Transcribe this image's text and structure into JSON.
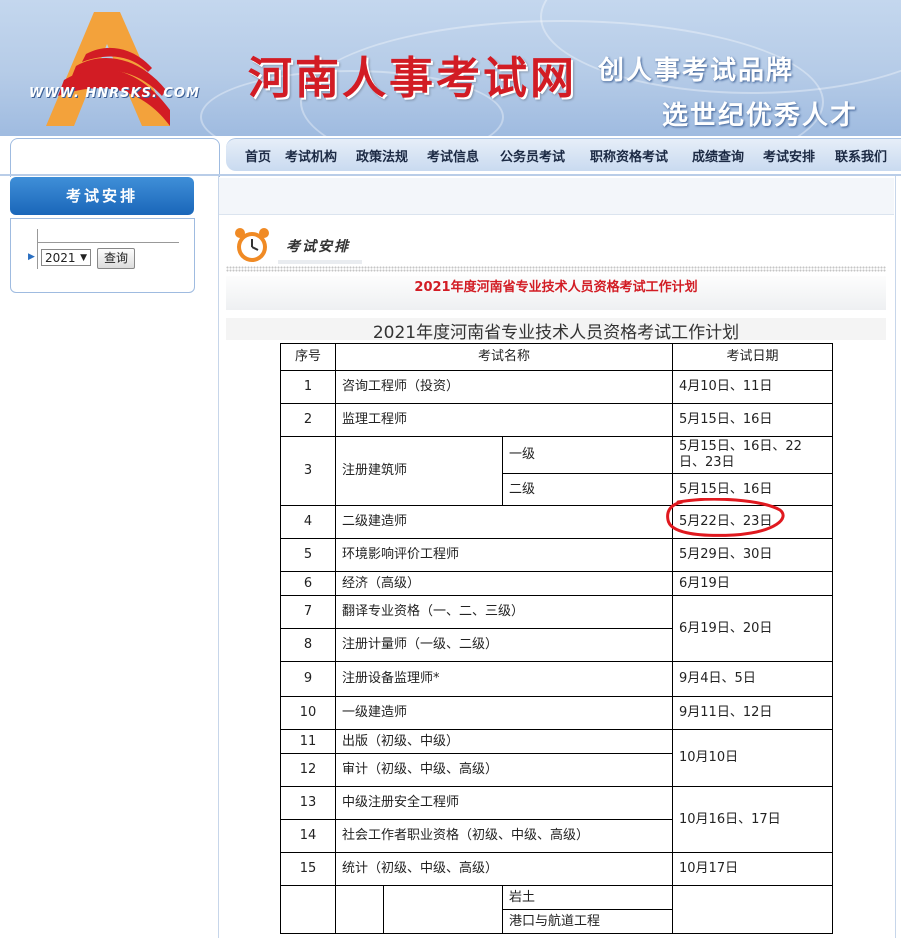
{
  "header": {
    "logo_url_text": "WWW. HNRSKS. COM",
    "site_title": "河南人事考试网",
    "slogan_line1": "创人事考试品牌",
    "slogan_line2": "选世纪优秀人才"
  },
  "nav": {
    "items": [
      {
        "label": "首页"
      },
      {
        "label": "考试机构"
      },
      {
        "label": "政策法规"
      },
      {
        "label": "考试信息"
      },
      {
        "label": "公务员考试"
      },
      {
        "label": "职称资格考试"
      },
      {
        "label": "成绩查询"
      },
      {
        "label": "考试安排"
      },
      {
        "label": "联系我们"
      }
    ]
  },
  "sidebar": {
    "title": "考试安排",
    "year_value": "2021",
    "query_button": "查询"
  },
  "content": {
    "section_heading": "考试安排",
    "notice_title": "2021年度河南省专业技术人员资格考试工作计划",
    "table_title": "2021年度河南省专业技术人员资格考试工作计划",
    "table": {
      "headers": {
        "seq": "序号",
        "name": "考试名称",
        "date": "考试日期"
      },
      "rows": {
        "r1": {
          "seq": "1",
          "name": "咨询工程师（投资）",
          "date": "4月10日、11日"
        },
        "r2": {
          "seq": "2",
          "name": "监理工程师",
          "date": "5月15日、16日"
        },
        "r3": {
          "seq": "3",
          "name": "注册建筑师",
          "sub1": "一级",
          "date1": "5月15日、16日、22日、23日",
          "sub2": "二级",
          "date2": "5月15日、16日"
        },
        "r4": {
          "seq": "4",
          "name": "二级建造师",
          "date": "5月22日、23日"
        },
        "r5": {
          "seq": "5",
          "name": "环境影响评价工程师",
          "date": "5月29日、30日"
        },
        "r6": {
          "seq": "6",
          "name": "经济（高级）",
          "date": "6月19日"
        },
        "r7": {
          "seq": "7",
          "name": "翻译专业资格（一、二、三级）"
        },
        "r8": {
          "seq": "8",
          "name": "注册计量师（一级、二级）"
        },
        "r7_8_date": "6月19日、20日",
        "r9": {
          "seq": "9",
          "name": "注册设备监理师*",
          "date": "9月4日、5日"
        },
        "r10": {
          "seq": "10",
          "name": "一级建造师",
          "date": "9月11日、12日"
        },
        "r11": {
          "seq": "11",
          "name": "出版（初级、中级）"
        },
        "r12": {
          "seq": "12",
          "name": "审计（初级、中级、高级）"
        },
        "r11_12_date": "10月10日",
        "r13": {
          "seq": "13",
          "name": "中级注册安全工程师"
        },
        "r14": {
          "seq": "14",
          "name": "社会工作者职业资格（初级、中级、高级）"
        },
        "r13_14_date": "10月16日、17日",
        "r15": {
          "seq": "15",
          "name": "统计（初级、中级、高级）",
          "date": "10月17日"
        },
        "r16": {
          "sub1": "岩土",
          "sub2": "港口与航道工程"
        }
      }
    },
    "highlight_color": "#e0191f"
  }
}
